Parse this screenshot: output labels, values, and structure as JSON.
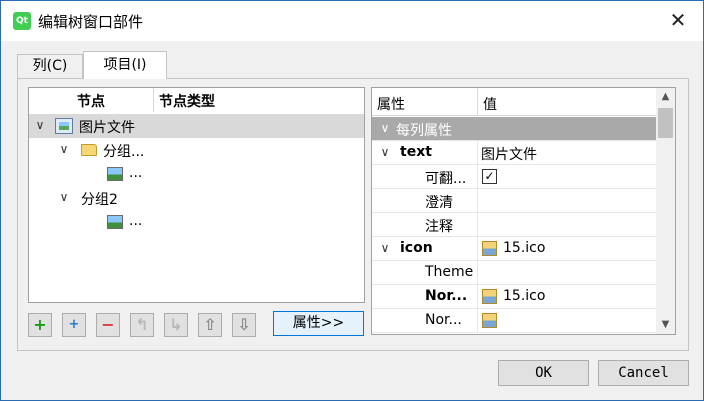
{
  "window": {
    "title": "编辑树窗口部件",
    "app_icon_text": "Qt"
  },
  "tabs": [
    {
      "label": "列(C)"
    },
    {
      "label": "项目(I)"
    }
  ],
  "tree": {
    "columns": [
      "节点",
      "节点类型"
    ],
    "rows": [
      {
        "label": "图片文件"
      },
      {
        "label": "分组..."
      },
      {
        "label": "..."
      },
      {
        "label": "分组2"
      },
      {
        "label": "..."
      }
    ]
  },
  "toolbar": {
    "add": "+",
    "add_child": "+",
    "remove": "−",
    "move_up_level": "↰",
    "move_down_level": "↳",
    "move_up": "⇧",
    "move_down": "⇩",
    "properties_label": "属性>>"
  },
  "properties": {
    "header": [
      "属性",
      "值"
    ],
    "rows": [
      {
        "name": "每列属性",
        "value": ""
      },
      {
        "name": "text",
        "value": "图片文件"
      },
      {
        "name": "可翻...",
        "value": "✓"
      },
      {
        "name": "澄清",
        "value": ""
      },
      {
        "name": "注释",
        "value": ""
      },
      {
        "name": "icon",
        "value": "15.ico"
      },
      {
        "name": "Theme",
        "value": ""
      },
      {
        "name": "Nor...",
        "value": "15.ico"
      },
      {
        "name": "Nor...",
        "value": ""
      }
    ]
  },
  "buttons": {
    "ok": "OK",
    "cancel": "Cancel"
  }
}
